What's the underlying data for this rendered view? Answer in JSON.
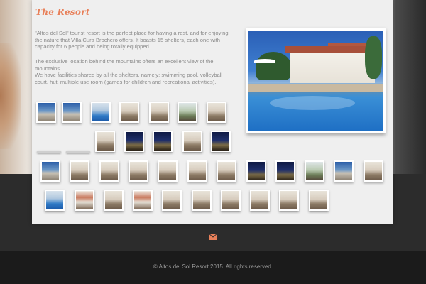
{
  "page": {
    "title": "The Resort",
    "paragraphs": [
      "\"Altos del Sol\" tourist resort is the perfect place for having a rest, and for enjoying the nature that Villa Cura Brochero offers. It boasts 15 shelters, each one with capacity for 6 people and being totally equipped.",
      "The exclusive location behind the mountains offers an excellent view of the mountains.\nWe have facilities shared by all the shelters, namely: swimming pool, volleyball court, hut, multiple use room (games for children and recreational activities)."
    ]
  },
  "gallery": {
    "feature_image": "resort-pool-photo",
    "thumbnail_kinds": [
      "t-b",
      "t-b",
      "t-p",
      "t-w",
      "t-w",
      "t-g",
      "t-w",
      "t-w",
      "t-n",
      "t-n",
      "t-w",
      "t-n",
      "t-b",
      "t-w",
      "t-w",
      "t-w",
      "t-w",
      "t-w",
      "t-w",
      "t-n",
      "t-n",
      "t-g",
      "t-b",
      "t-w",
      "t-p",
      "t-r",
      "t-w",
      "t-r",
      "t-w",
      "t-w",
      "t-w",
      "t-w",
      "t-w",
      "t-w",
      "t-w"
    ]
  },
  "footer": {
    "contact_icon": "mail-icon",
    "copyright": "© Altos del Sol Resort 2015. All rights reserved."
  },
  "colors": {
    "accent": "#e8805a",
    "text_muted": "#8a8a8a",
    "footer_bg": "#1b1b1b"
  }
}
